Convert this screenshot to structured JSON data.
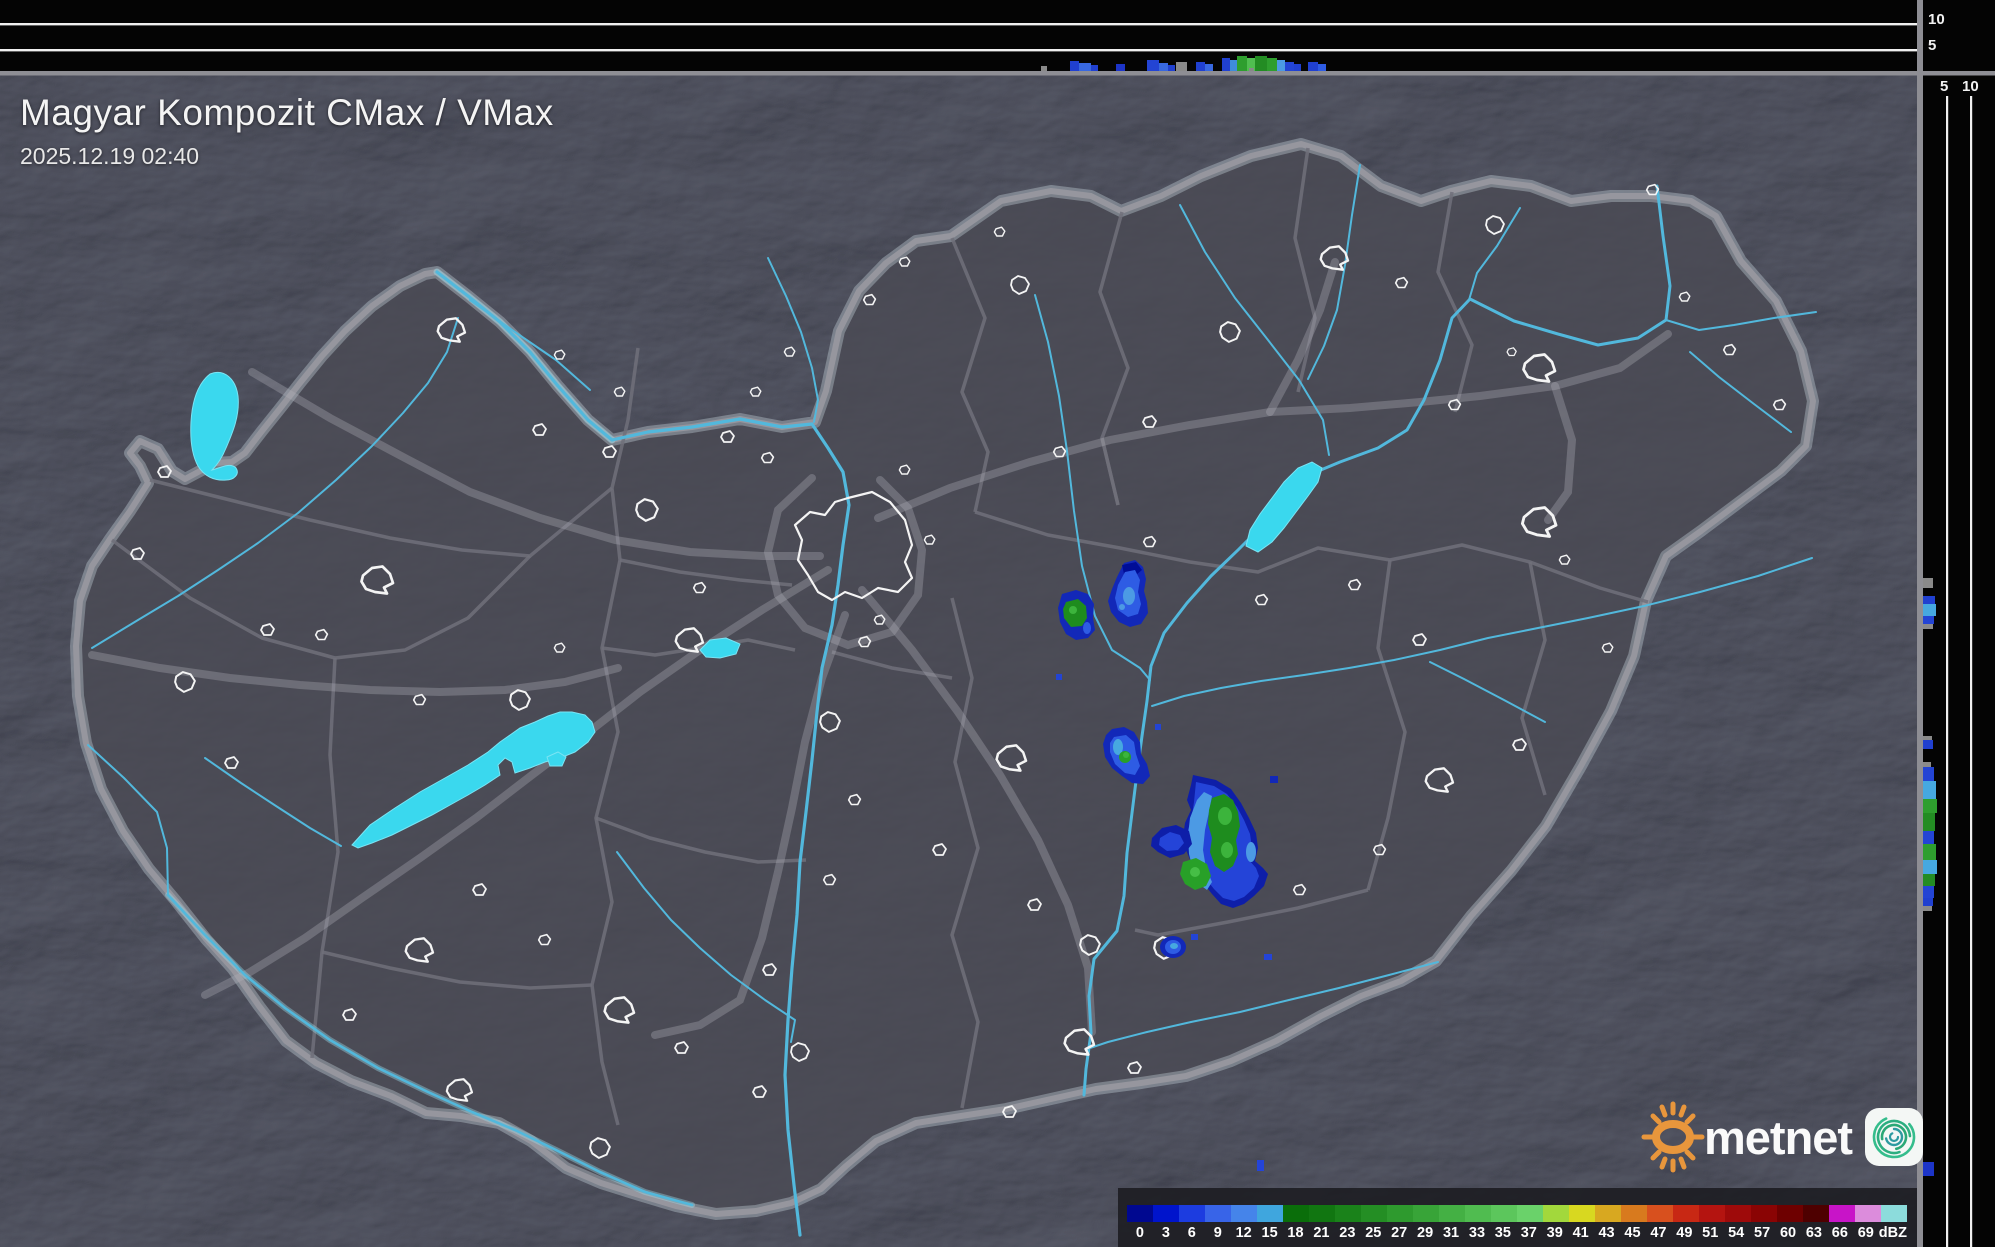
{
  "header": {
    "title": "Magyar Kompozit CMax / VMax",
    "datetime": "2025.12.19 02:40"
  },
  "legend": {
    "unit": "dBZ",
    "stops": [
      {
        "label": "0",
        "color": "#000890"
      },
      {
        "label": "3",
        "color": "#0014CC"
      },
      {
        "label": "6",
        "color": "#1C3CE0"
      },
      {
        "label": "9",
        "color": "#3864E8"
      },
      {
        "label": "12",
        "color": "#4584EA"
      },
      {
        "label": "15",
        "color": "#3FA6DE"
      },
      {
        "label": "18",
        "color": "#0A6E0A"
      },
      {
        "label": "21",
        "color": "#117611"
      },
      {
        "label": "23",
        "color": "#1A821A"
      },
      {
        "label": "25",
        "color": "#248E24"
      },
      {
        "label": "27",
        "color": "#2E9A2E"
      },
      {
        "label": "29",
        "color": "#38A438"
      },
      {
        "label": "31",
        "color": "#44B044"
      },
      {
        "label": "33",
        "color": "#50BC50"
      },
      {
        "label": "35",
        "color": "#5CC65C"
      },
      {
        "label": "37",
        "color": "#6AD26A"
      },
      {
        "label": "39",
        "color": "#A2D83C"
      },
      {
        "label": "41",
        "color": "#D8D820"
      },
      {
        "label": "43",
        "color": "#D8A820"
      },
      {
        "label": "45",
        "color": "#D87A1E"
      },
      {
        "label": "47",
        "color": "#D8501E"
      },
      {
        "label": "49",
        "color": "#C82814"
      },
      {
        "label": "51",
        "color": "#B41410"
      },
      {
        "label": "54",
        "color": "#9E0A0A"
      },
      {
        "label": "57",
        "color": "#8A0404"
      },
      {
        "label": "60",
        "color": "#6E0000"
      },
      {
        "label": "63",
        "color": "#4E0000"
      },
      {
        "label": "66",
        "color": "#C814C8"
      },
      {
        "label": "69",
        "color": "#DC8CDC"
      },
      {
        "label": "dBZ",
        "color": "#8CDCDC"
      }
    ]
  },
  "profile_axes": {
    "top_km_labels": [
      "10",
      "5"
    ],
    "right_km_labels": [
      "5",
      "10"
    ]
  },
  "branding": {
    "logo_text": "metnet",
    "sun_color": "#E8963C",
    "spiral_color": "#2FB38A"
  },
  "accent_colors": {
    "lake_water": "#3AD8EE",
    "river": "#52B8DC",
    "country_border": "#9A9AA2",
    "echo_blue": "#2444D8",
    "echo_green": "#1E8C1E"
  }
}
